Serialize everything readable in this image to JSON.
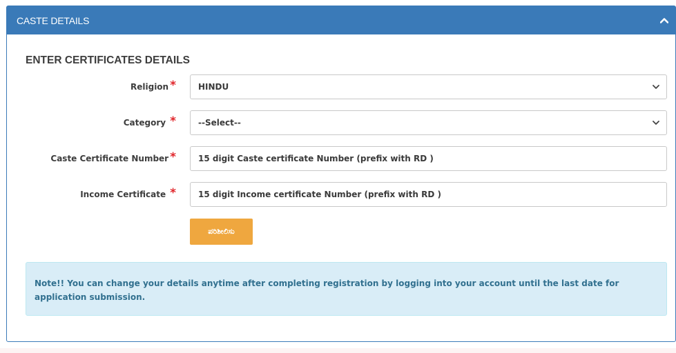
{
  "panel": {
    "title": "CASTE DETAILS",
    "collapse_icon": "chevron-up-icon",
    "header_color": "#3a7ab8"
  },
  "section_title": "ENTER CERTIFICATES DETAILS",
  "fields": {
    "religion": {
      "label": "Religion",
      "required_mark": "*",
      "value": "HINDU"
    },
    "category": {
      "label": "Category",
      "required_mark": "*",
      "value": "--Select--"
    },
    "caste_certificate": {
      "label": "Caste Certificate Number",
      "required_mark": "*",
      "placeholder": "15 digit Caste certificate Number (prefix with RD )"
    },
    "income_certificate": {
      "label": "Income Certificate",
      "required_mark": "*",
      "placeholder": "15 digit Income certificate Number (prefix with RD )"
    }
  },
  "submit": {
    "label": "ಪರಿಶೀಲಿಸು",
    "color": "#efa73f"
  },
  "note": {
    "text": "Note!! You can change your details anytime after completing registration by logging into your account until the last date for application submission."
  }
}
